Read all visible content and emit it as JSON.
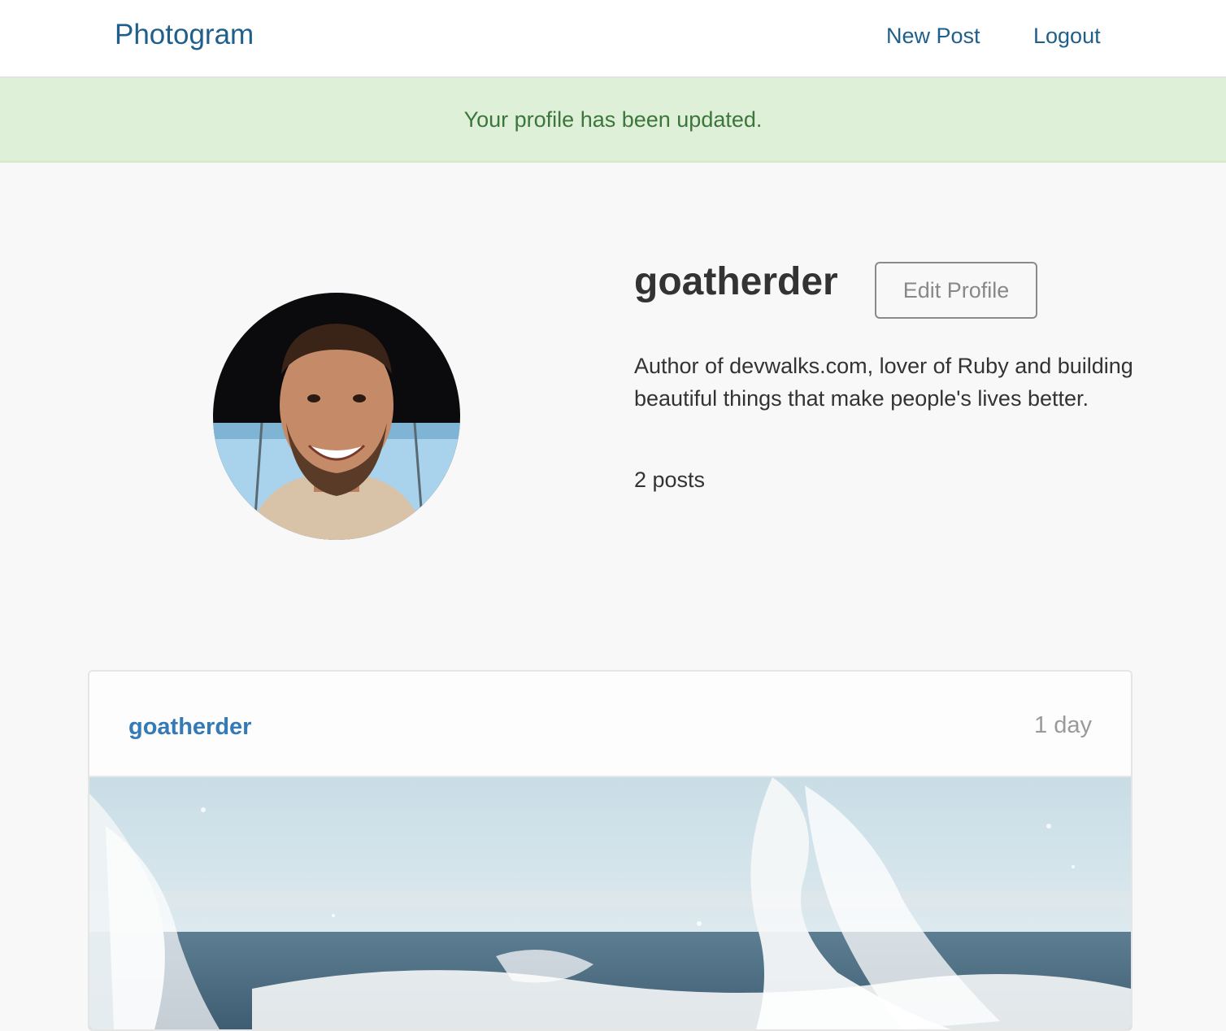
{
  "navbar": {
    "brand": "Photogram",
    "links": [
      "New Post",
      "Logout"
    ]
  },
  "alert": {
    "message": "Your profile has been updated."
  },
  "profile": {
    "username": "goatherder",
    "edit_button": "Edit Profile",
    "bio": "Author of devwalks.com, lover of Ruby and building beautiful things that make people's lives better.",
    "posts_count": "2 posts"
  },
  "post": {
    "username": "goatherder",
    "time": "1 day"
  },
  "colors": {
    "link": "#1f5f8b",
    "alert_bg": "#dff0d8",
    "alert_text": "#3c763d",
    "post_user": "#337ab7"
  }
}
